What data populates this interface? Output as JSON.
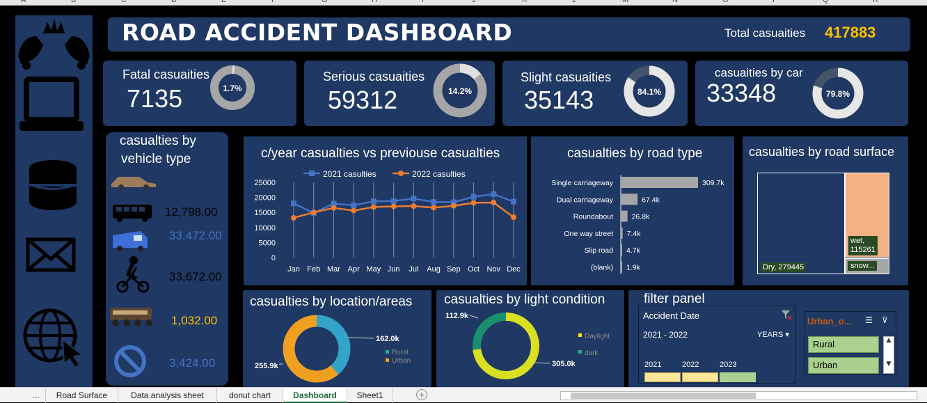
{
  "excel": {
    "columns": [
      "A",
      "B",
      "C",
      "D",
      "E",
      "F",
      "G",
      "H",
      "I",
      "J",
      "K",
      "L",
      "M",
      "N",
      "O",
      "P",
      "Q",
      "R"
    ],
    "sheet_tabs": [
      "...",
      "Road Surface",
      "Data analysis sheet",
      "donut chart",
      "Dashboard",
      "Sheet1"
    ],
    "active_tab": "Dashboard"
  },
  "header": {
    "title": "ROAD ACCIDENT DASHBOARD",
    "total_label": "Total casuaities",
    "total_value": "417883"
  },
  "kpis": [
    {
      "label": "Fatal casuaities",
      "value": "7135",
      "pct": "1.7%",
      "fraction": 0.017
    },
    {
      "label": "Serious  casuaities",
      "value": "59312",
      "pct": "14.2%",
      "fraction": 0.142
    },
    {
      "label": "Slight casuaities",
      "value": "35143",
      "pct": "84.1%",
      "fraction": 0.841
    },
    {
      "label": "casuaities by car",
      "value": "33348",
      "pct": "79.8%",
      "fraction": 0.798
    }
  ],
  "vehicle": {
    "title_line1": "casualties by",
    "title_line2": "vehicle type",
    "values": [
      "12,798.00",
      "33,472.00",
      "33,672.00",
      "1,032.00",
      "3,424.00"
    ],
    "icons": [
      "car-icon",
      "bus-icon",
      "van-icon",
      "cyclist-icon",
      "agricultural-vehicle-icon",
      "other-vehicle-icon"
    ]
  },
  "sidebar_icons": [
    "crash-logo-icon",
    "laptop-icon",
    "database-icon",
    "mail-icon",
    "globe-cursor-icon"
  ],
  "colors": {
    "panel": "#1f3864",
    "series2021": "#4472c4",
    "series2022": "#ed7d31",
    "accent": "#ffc000"
  },
  "chart_data": [
    {
      "type": "line",
      "title": "c/year casualties vs previouse casualties",
      "categories": [
        "Jan",
        "Feb",
        "Mar",
        "Apr",
        "May",
        "Jun",
        "Jul",
        "Aug",
        "Sep",
        "Oct",
        "Nov",
        "Dec"
      ],
      "series": [
        {
          "name": "2021 casulties",
          "values": [
            18000,
            14800,
            17900,
            17400,
            18700,
            18800,
            19600,
            18500,
            18400,
            20200,
            21100,
            18600
          ]
        },
        {
          "name": "2022 casulties",
          "values": [
            13200,
            15000,
            16500,
            15600,
            16800,
            17000,
            17100,
            16600,
            17200,
            18200,
            18300,
            13400
          ]
        }
      ],
      "ylim": [
        0,
        25000
      ],
      "yticks": [
        "25000",
        "20000",
        "15000",
        "10000",
        "5000",
        "0"
      ]
    },
    {
      "type": "bar",
      "title": "casualties by road type",
      "categories": [
        "Single carriageway",
        "Dual carriageway",
        "Roundabout",
        "One way street",
        "Slip road",
        "(blank)"
      ],
      "values": [
        309700,
        67400,
        26800,
        7400,
        4700,
        1900
      ],
      "labels": [
        "309.7k",
        "67.4k",
        "26.8k",
        "7.4k",
        "4.7k",
        "1.9k"
      ]
    },
    {
      "type": "heatmap",
      "title": "casualties by road surface",
      "categories": [
        "Dry",
        "wet",
        "snow..."
      ],
      "values": [
        279445,
        115261,
        null
      ],
      "labels": [
        "Dry, 279445",
        "wet,",
        "115261",
        "snow..."
      ]
    },
    {
      "type": "pie",
      "title": "casualties by location/areas",
      "categories": [
        "Rural",
        "Urban"
      ],
      "values": [
        162000,
        255900
      ],
      "labels": [
        "162.0k",
        "255.9k"
      ]
    },
    {
      "type": "pie",
      "title": "casualties by light condition",
      "categories": [
        "Daylight",
        "dark"
      ],
      "values": [
        305000,
        112900
      ],
      "labels": [
        "305.0k",
        "112.9k"
      ]
    }
  ],
  "filter": {
    "title": "filter panel",
    "date_label": "Accident Date",
    "date_range": "2021 - 2022",
    "period": "YEARS",
    "years": [
      "2021",
      "2022",
      "2023"
    ],
    "urban_title": "Urban_o...",
    "urban_items": [
      "Rural",
      "Urban"
    ]
  }
}
